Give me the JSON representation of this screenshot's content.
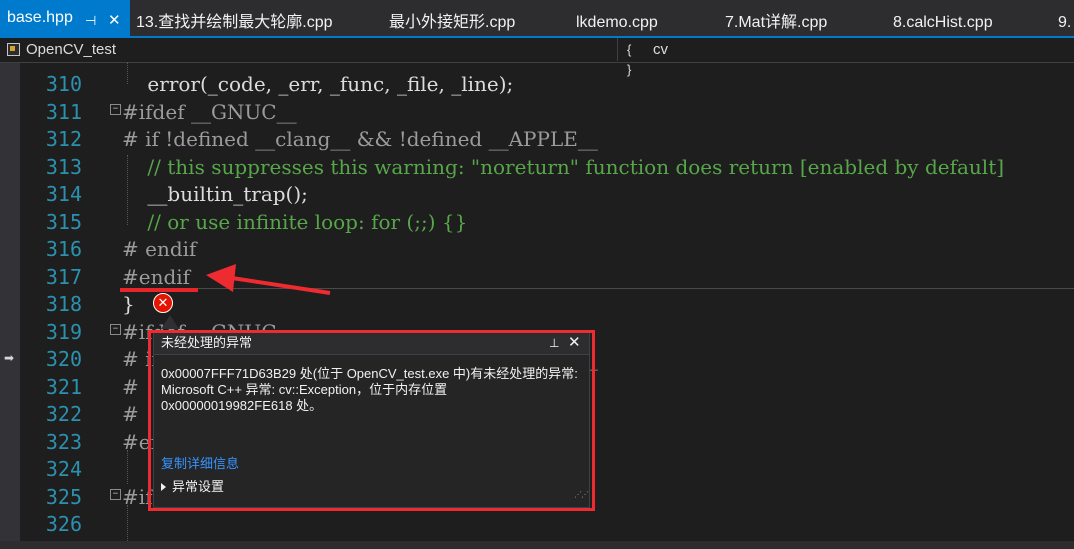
{
  "tabs": [
    {
      "label": "base.hpp",
      "active": true
    },
    {
      "label": "13.查找并绘制最大轮廓.cpp"
    },
    {
      "label": "最小外接矩形.cpp"
    },
    {
      "label": "lkdemo.cpp"
    },
    {
      "label": "7.Mat详解.cpp"
    },
    {
      "label": "8.calcHist.cpp"
    },
    {
      "label": "9."
    }
  ],
  "nav": {
    "project": "OpenCV_test",
    "scope": "cv"
  },
  "code": [
    {
      "ln": "310",
      "text": "    error(_code, _err, _func, _file, _line);",
      "kind": "code"
    },
    {
      "ln": "311",
      "text": "#ifdef __GNUC__",
      "kind": "pp"
    },
    {
      "ln": "312",
      "text": "# if !defined __clang__ && !defined __APPLE__",
      "kind": "pp"
    },
    {
      "ln": "313",
      "text": "    // this suppresses this warning: \"noreturn\" function does return [enabled by default]",
      "kind": "cm"
    },
    {
      "ln": "314",
      "text": "    __builtin_trap();",
      "kind": "code"
    },
    {
      "ln": "315",
      "text": "    // or use infinite loop: for (;;) {}",
      "kind": "cm"
    },
    {
      "ln": "316",
      "text": "# endif",
      "kind": "pp"
    },
    {
      "ln": "317",
      "text": "#endif",
      "kind": "pp"
    },
    {
      "ln": "318",
      "text": "}",
      "kind": "code"
    },
    {
      "ln": "319",
      "text": "#ifdef __GNUC__",
      "kind": "pp"
    },
    {
      "ln": "320",
      "text": "# if !defined __clang__ && !defined __APPLE__",
      "kind": "pp"
    },
    {
      "ln": "321",
      "text": "# ",
      "kind": "pp"
    },
    {
      "ln": "322",
      "text": "# ",
      "kind": "pp"
    },
    {
      "ln": "323",
      "text": "#en",
      "kind": "pp"
    },
    {
      "ln": "324",
      "text": "",
      "kind": "code"
    },
    {
      "ln": "325",
      "text": "#ifdef",
      "kind": "pp"
    },
    {
      "ln": "326",
      "text": "",
      "kind": "code"
    }
  ],
  "popup": {
    "title": "未经处理的异常",
    "message": "0x00007FFF71D63B29 处(位于 OpenCV_test.exe 中)有未经处理的异常: Microsoft C++ 异常: cv::Exception，位于内存位置\n0x00000019982FE618 处。",
    "copy_link": "复制详细信息",
    "settings": "异常设置"
  },
  "colors": {
    "accent": "#007acc",
    "annotation_red": "#ed2b30",
    "error_red": "#e51400"
  }
}
